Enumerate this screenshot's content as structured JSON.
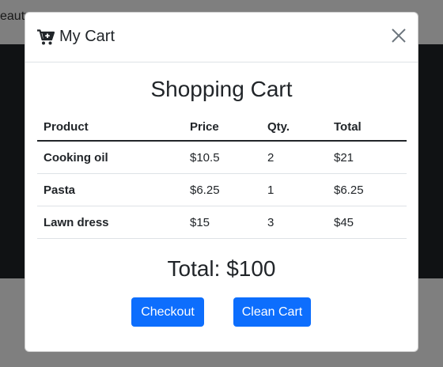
{
  "background": {
    "nav_partial_text": "eauty"
  },
  "modal": {
    "title": "My Cart",
    "heading": "Shopping Cart",
    "close_icon": "close-icon",
    "cart_icon": "cart-plus-icon"
  },
  "table": {
    "headers": [
      "Product",
      "Price",
      "Qty.",
      "Total"
    ],
    "rows": [
      {
        "product": "Cooking oil",
        "price": "$10.5",
        "qty": "2",
        "total": "$21"
      },
      {
        "product": "Pasta",
        "price": "$6.25",
        "qty": "1",
        "total": "$6.25"
      },
      {
        "product": "Lawn dress",
        "price": "$15",
        "qty": "3",
        "total": "$45"
      }
    ]
  },
  "summary": {
    "total_text": "Total: $100"
  },
  "actions": {
    "checkout_label": "Checkout",
    "clean_label": "Clean Cart"
  },
  "colors": {
    "primary": "#0d6efd",
    "backdrop": "rgba(0,0,0,0.5)",
    "dark_section": "#212529"
  }
}
